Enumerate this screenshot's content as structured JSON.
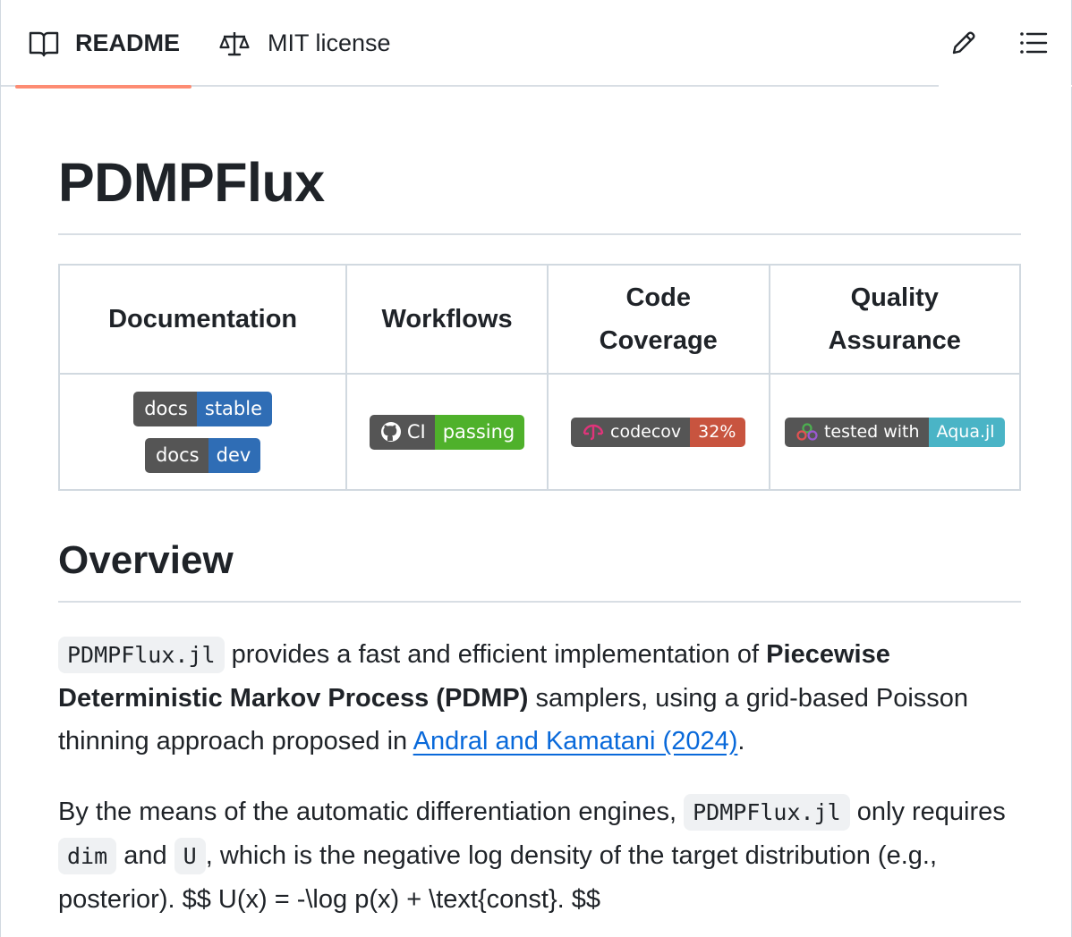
{
  "tabs": {
    "readme": "README",
    "license": "MIT license"
  },
  "title": "PDMPFlux",
  "table": {
    "headers": [
      "Documentation",
      "Workflows",
      "Code Coverage",
      "Quality Assurance"
    ],
    "header_lines": {
      "code": [
        "Code",
        "Coverage"
      ],
      "quality": [
        "Quality",
        "Assurance"
      ]
    },
    "badges": {
      "docs_stable": {
        "left": "docs",
        "right": "stable"
      },
      "docs_dev": {
        "left": "docs",
        "right": "dev"
      },
      "ci": {
        "left": "CI",
        "right": "passing"
      },
      "codecov": {
        "left": "codecov",
        "right": "32%"
      },
      "aqua": {
        "left": "tested with",
        "right": "Aqua.jl"
      }
    }
  },
  "overview": {
    "heading": "Overview",
    "p1": {
      "code": "PDMPFlux.jl",
      "t1": " provides a fast and efficient implementation of ",
      "bold": "Piecewise Deterministic Markov Process (PDMP)",
      "t2": " samplers, using a grid-based Poisson thinning approach proposed in ",
      "link": "Andral and Kamatani (2024)",
      "t3": "."
    },
    "p2": {
      "t1": "By the means of the automatic differentiation engines, ",
      "code1": "PDMPFlux.jl",
      "t2": " only requires ",
      "code2": "dim",
      "t3": " and ",
      "code3": "U",
      "t4": ", which is the negative log density of the target distribution (e.g., posterior). $$ U(x) = -\\log p(x) + \\text{const}. $$"
    }
  },
  "icons": [
    "book-icon",
    "law-icon",
    "pencil-icon",
    "list-icon",
    "github-icon",
    "codecov-icon",
    "aqua-icon"
  ],
  "colors": {
    "tab_underline": "#fd8c73",
    "link": "#0969da",
    "badge_blue": "#2f6db5",
    "badge_green": "#4fb12b",
    "badge_red": "#c8543f",
    "badge_teal": "#4ab4c6"
  }
}
